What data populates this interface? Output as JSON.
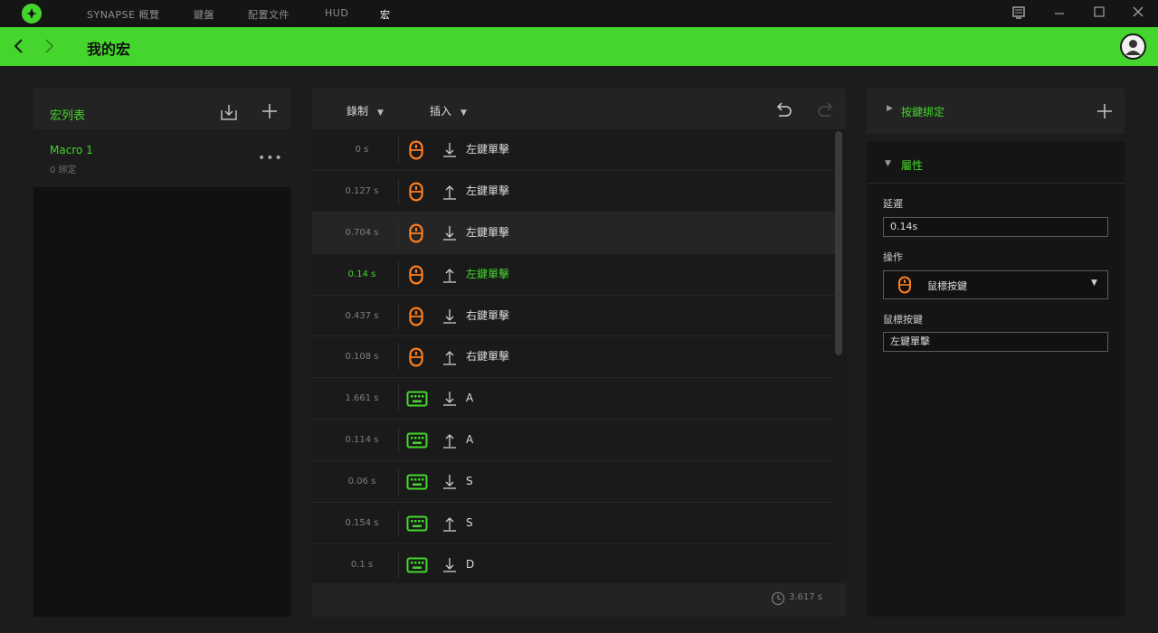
{
  "app": {
    "tabs": [
      "SYNAPSE 概覽",
      "鍵盤",
      "配置文件",
      "HUD",
      "宏"
    ],
    "active_tab_index": 4,
    "window_controls": [
      "notifications",
      "minimize",
      "maximize",
      "close"
    ]
  },
  "header": {
    "title": "我的宏",
    "accent": "#44d62c"
  },
  "macro_list": {
    "title": "宏列表",
    "items": [
      {
        "name": "Macro 1",
        "sub": "0 綁定"
      }
    ]
  },
  "editor": {
    "toolbar": {
      "record_label": "錄制",
      "insert_label": "插入"
    },
    "events": [
      {
        "delay": "0 s",
        "device": "mouse",
        "direction": "down",
        "label": "左鍵單擊"
      },
      {
        "delay": "0.127 s",
        "device": "mouse",
        "direction": "up",
        "label": "左鍵單擊"
      },
      {
        "delay": "0.704 s",
        "device": "mouse",
        "direction": "down",
        "label": "左鍵單擊"
      },
      {
        "delay": "0.14 s",
        "device": "mouse",
        "direction": "up",
        "label": "左鍵單擊"
      },
      {
        "delay": "0.437 s",
        "device": "mouse",
        "direction": "down",
        "label": "右鍵單擊"
      },
      {
        "delay": "0.108 s",
        "device": "mouse",
        "direction": "up",
        "label": "右鍵單擊"
      },
      {
        "delay": "1.661 s",
        "device": "keyboard",
        "direction": "down",
        "label": "A"
      },
      {
        "delay": "0.114 s",
        "device": "keyboard",
        "direction": "up",
        "label": "A"
      },
      {
        "delay": "0.06 s",
        "device": "keyboard",
        "direction": "down",
        "label": "S"
      },
      {
        "delay": "0.154 s",
        "device": "keyboard",
        "direction": "up",
        "label": "S"
      },
      {
        "delay": "0.1 s",
        "device": "keyboard",
        "direction": "down",
        "label": "D"
      }
    ],
    "hover_index": 2,
    "selected_index": 3,
    "total_time": "3.617 s"
  },
  "hotkey": {
    "title": "按鍵綁定"
  },
  "properties": {
    "title": "屬性",
    "delay_label": "延遲",
    "delay_value": "0.14s",
    "action_label": "操作",
    "action_value": "鼠標按鍵",
    "button_label": "鼠標按鍵",
    "button_value": "左鍵單擊"
  }
}
